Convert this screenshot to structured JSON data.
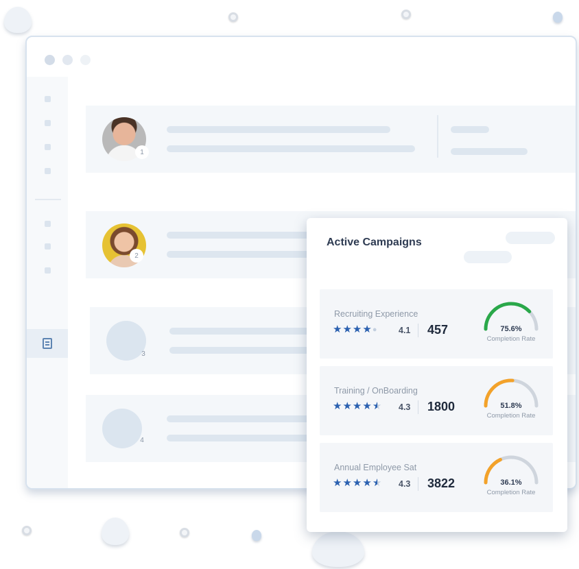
{
  "list": {
    "rows": [
      {
        "rank": "1",
        "avatar": "male-portrait"
      },
      {
        "rank": "2",
        "avatar": "female-portrait"
      },
      {
        "rank": "3",
        "avatar": "placeholder"
      },
      {
        "rank": "4",
        "avatar": "placeholder"
      }
    ]
  },
  "sidebar": {
    "active_icon": "document-icon"
  },
  "campaigns": {
    "title": "Active Campaigns",
    "items": [
      {
        "name": "Recruiting Experience",
        "rating": "4.1",
        "rating_value": 4.1,
        "count": "457",
        "completion": "75.6%",
        "completion_value": 0.756,
        "completion_label": "Completion Rate",
        "gauge_color": "#2aa84a"
      },
      {
        "name": "Training / OnBoarding",
        "rating": "4.3",
        "rating_value": 4.3,
        "count": "1800",
        "completion": "51.8%",
        "completion_value": 0.518,
        "completion_label": "Completion Rate",
        "gauge_color": "#f3a22a"
      },
      {
        "name": "Annual Employee Sat",
        "rating": "4.3",
        "rating_value": 4.3,
        "count": "3822",
        "completion": "36.1%",
        "completion_value": 0.361,
        "completion_label": "Completion Rate",
        "gauge_color": "#f3a22a"
      }
    ]
  },
  "colors": {
    "accent_blue": "#2a60b0",
    "gauge_track": "#cfd5dd",
    "text_dark": "#2e3b52"
  }
}
